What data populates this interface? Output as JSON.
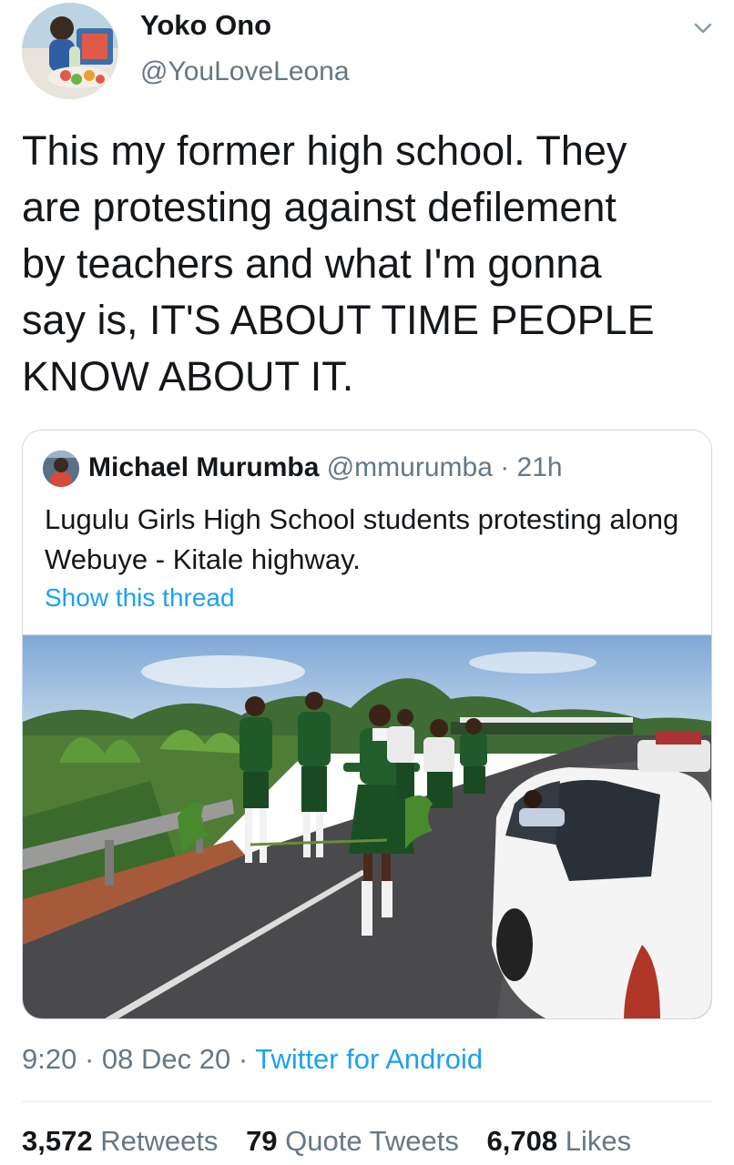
{
  "author": {
    "display_name": "Yoko Ono",
    "handle": "@YouLoveLeona",
    "avatar_icon": "profile-photo"
  },
  "tweet": {
    "text": "This my former high school. They\nare protesting against defilement\nby teachers and what I'm gonna\nsay is, IT'S ABOUT TIME PEOPLE\nKNOW ABOUT IT."
  },
  "quoted": {
    "display_name": "Michael Murumba",
    "handle": "@mmurumba",
    "separator": " · ",
    "time": "21h",
    "text": "Lugulu Girls High School students protesting along Webuye - Kitale highway.",
    "thread_link": "Show this thread",
    "photo_icon": "photo-students-protest-on-highway"
  },
  "meta": {
    "time": "9:20",
    "dot1": " · ",
    "date": "08 Dec 20",
    "dot2": " · ",
    "source": "Twitter for Android"
  },
  "stats": {
    "retweets_count": "3,572",
    "retweets_label": "Retweets",
    "quotes_count": "79",
    "quotes_label": "Quote Tweets",
    "likes_count": "6,708",
    "likes_label": "Likes"
  },
  "colors": {
    "link": "#1da1f2",
    "text_primary": "#14171a",
    "text_secondary": "#657786",
    "border": "#cfd9de"
  }
}
